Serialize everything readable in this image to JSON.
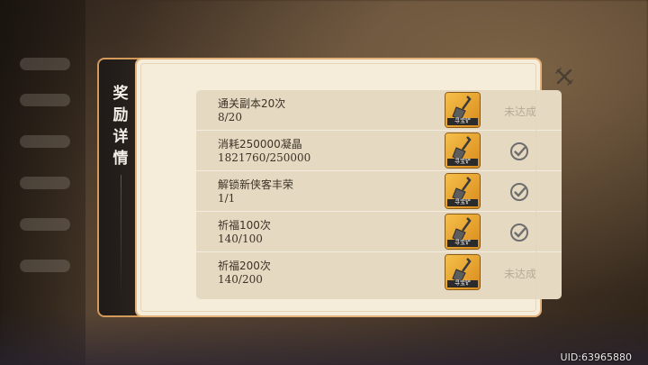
{
  "panel": {
    "title_chars": [
      "奖",
      "励",
      "详",
      "情"
    ]
  },
  "rows": [
    {
      "title": "通关副本20次",
      "progress": "8/20",
      "item_tag": "寻宝铲",
      "status": "未达成",
      "claimed": false
    },
    {
      "title": "消耗250000凝晶",
      "progress": "1821760/250000",
      "item_tag": "寻宝铲",
      "status": "",
      "claimed": true
    },
    {
      "title": "解锁新侠客丰荣",
      "progress": "1/1",
      "item_tag": "寻宝铲",
      "status": "",
      "claimed": true
    },
    {
      "title": "祈福100次",
      "progress": "140/100",
      "item_tag": "寻宝铲",
      "status": "",
      "claimed": true
    },
    {
      "title": "祈福200次",
      "progress": "140/200",
      "item_tag": "寻宝铲",
      "status": "未达成",
      "claimed": false
    }
  ],
  "footer": {
    "uid": "UID:63965880"
  },
  "colors": {
    "panel_border": "#e3b27a",
    "panel_bg": "#f5ecd9",
    "list_bg": "#e5d9c2",
    "side_bg": "#1f1a17",
    "item_gold": "#f6c04a"
  },
  "icons": {
    "close": "close-icon",
    "check": "check-circle-icon",
    "item": "treasure-shovel-icon"
  }
}
